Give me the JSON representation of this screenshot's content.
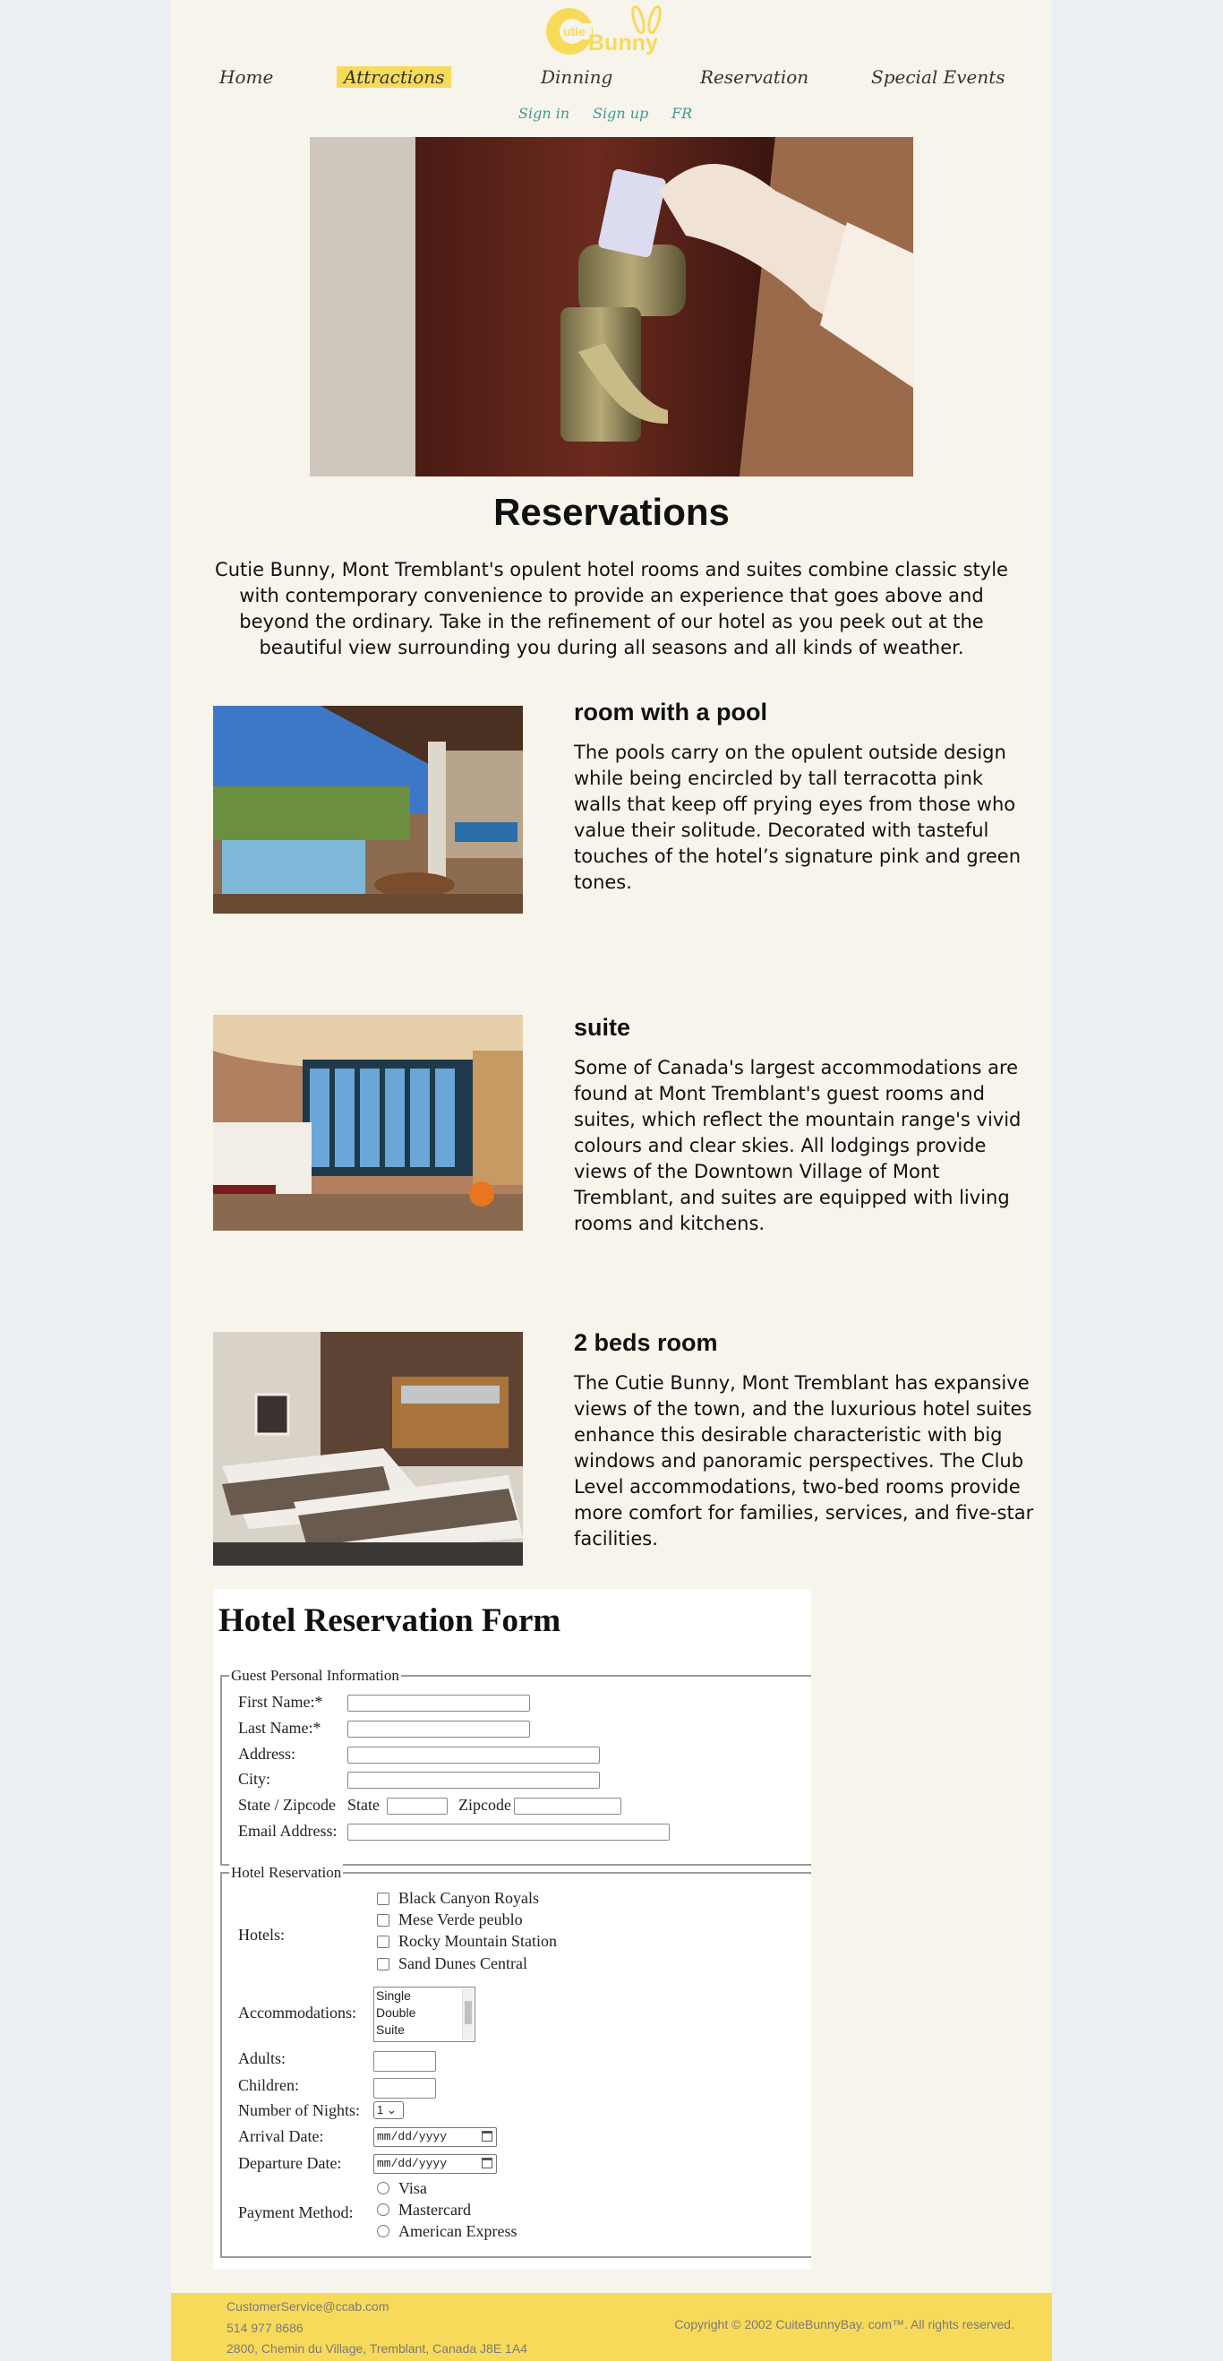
{
  "brand": {
    "logo_text_small": "utie",
    "logo_text_big": "Bunny",
    "logo_letter": "C",
    "colors": {
      "accent_yellow": "#f8da5a",
      "link_teal": "#3d9b8f",
      "page_bg": "#f7f4ec"
    }
  },
  "nav": {
    "items": [
      {
        "label": "Home"
      },
      {
        "label": "Attractions"
      },
      {
        "label": "Dinning"
      },
      {
        "label": "Reservation"
      },
      {
        "label": "Special Events"
      }
    ],
    "active": "Attractions"
  },
  "subnav": {
    "signin": "Sign in",
    "signup": "Sign up",
    "lang": "FR"
  },
  "page": {
    "title": "Reservations",
    "intro": "Cutie Bunny, Mont Tremblant's opulent hotel rooms and suites combine classic style with contemporary convenience to provide an experience that goes above and beyond the ordinary. Take in the refinement of our hotel as you peek out at the beautiful view surrounding you during all seasons and all kinds of weather."
  },
  "rooms": [
    {
      "title": "room with a pool",
      "description": "The pools carry on the opulent outside design while being encircled by tall terracotta pink walls that keep off prying eyes from those who value their solitude. Decorated with tasteful touches of the hotel’s signature pink and green tones."
    },
    {
      "title": "suite",
      "description": "Some of Canada's largest accommodations are found at Mont Tremblant's guest rooms and suites, which reflect the mountain range's vivid colours and clear skies. All lodgings provide views of the Downtown Village of Mont Tremblant, and suites are equipped with living rooms and kitchens."
    },
    {
      "title": "2 beds room",
      "description": "The Cutie Bunny, Mont Tremblant has expansive views of the town, and the luxurious hotel suites enhance this desirable characteristic with big windows and panoramic perspectives. The Club Level accommodations, two-bed rooms provide more comfort for families, services, and five-star facilities."
    }
  ],
  "form": {
    "title": "Hotel Reservation Form",
    "personal_legend": "Guest Personal Information",
    "first_name": "First Name:*",
    "last_name": "Last Name:*",
    "address": "Address:",
    "city": "City:",
    "state_zip": "State / Zipcode",
    "state": "State",
    "zipcode": "Zipcode",
    "email": "Email Address:",
    "reservation_legend": "Hotel Reservation",
    "hotels_label": "Hotels:",
    "hotels": [
      "Black Canyon Royals",
      "Mese Verde peublo",
      "Rocky Mountain Station",
      "Sand Dunes Central"
    ],
    "accommodations_label": "Accommodations:",
    "accommodations": [
      "Single",
      "Double",
      "Suite"
    ],
    "adults": "Adults:",
    "children": "Children:",
    "nights_label": "Number of Nights:",
    "nights_value": "1",
    "arrival": "Arrival Date:",
    "departure": "Departure Date:",
    "date_placeholder": "mm/dd/yyyy",
    "payment_label": "Payment Method:",
    "payments": [
      "Visa",
      "Mastercard",
      "American Express"
    ]
  },
  "footer": {
    "email": "CustomerService@ccab.com",
    "phone": "514 977 8686",
    "address": "2800, Chemin du Village, Tremblant, Canada J8E 1A4",
    "copyright": "Copyright © 2002 CuiteBunnyBay. com™. All rights reserved."
  }
}
